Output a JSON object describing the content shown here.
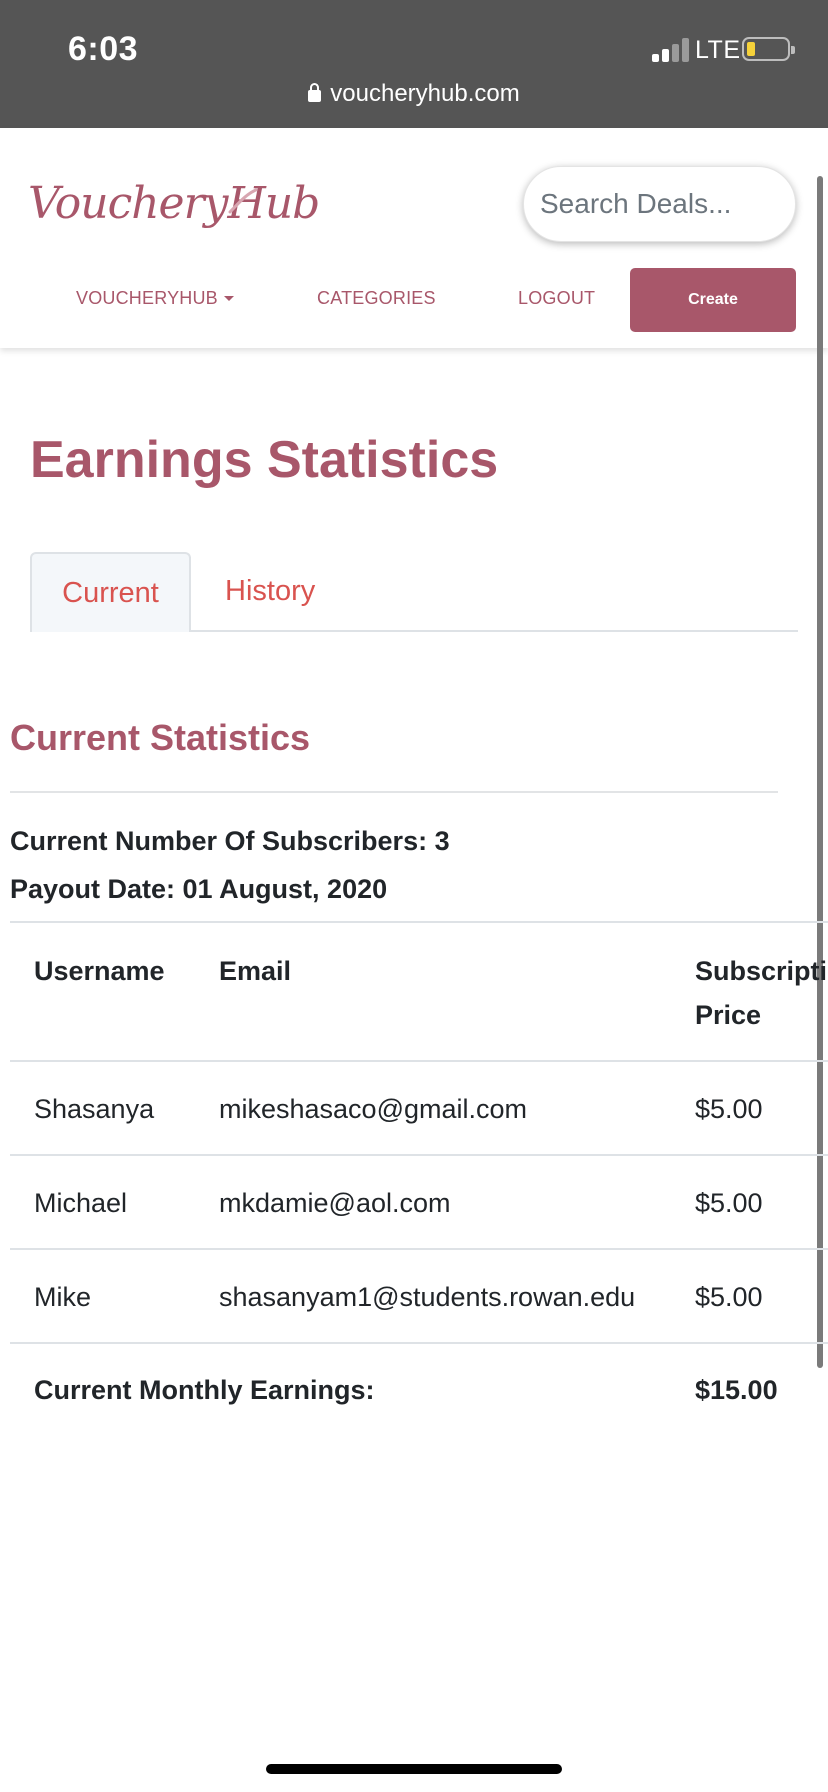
{
  "status_bar": {
    "time": "6:03",
    "network": "LTE",
    "battery_level": 0.15,
    "url": "voucheryhub.com"
  },
  "header": {
    "logo_text": "VoucheryHub",
    "search_placeholder": "Search Deals...",
    "nav": {
      "voucheryhub": "VOUCHERYHUB",
      "categories": "CATEGORIES",
      "logout": "LOGOUT",
      "create": "Create"
    }
  },
  "page": {
    "title": "Earnings Statistics",
    "tabs": [
      {
        "label": "Current",
        "active": true
      },
      {
        "label": "History",
        "active": false
      }
    ],
    "section_title": "Current Statistics",
    "subscribers_line": "Current Number Of Subscribers: 3",
    "payout_line": "Payout Date: 01 August, 2020"
  },
  "table": {
    "headers": {
      "username": "Username",
      "email": "Email",
      "price_line1": "Subscripti",
      "price_line2": "Price"
    },
    "rows": [
      {
        "username": "Shasanya",
        "email": "mikeshasaco@gmail.com",
        "price": "$5.00"
      },
      {
        "username": "Michael",
        "email": "mkdamie@aol.com",
        "price": "$5.00"
      },
      {
        "username": "Mike",
        "email": "shasanyam1@students.rowan.edu",
        "price": "$5.00"
      }
    ],
    "footer": {
      "label": "Current Monthly Earnings:",
      "total": "$15.00"
    }
  },
  "colors": {
    "brand": "#a8576a",
    "tab_link": "#d9534f",
    "status_bar": "#555555",
    "text": "#212529"
  },
  "icons": [
    "lock-icon",
    "signal-icon",
    "battery-icon",
    "caret-down-icon"
  ]
}
